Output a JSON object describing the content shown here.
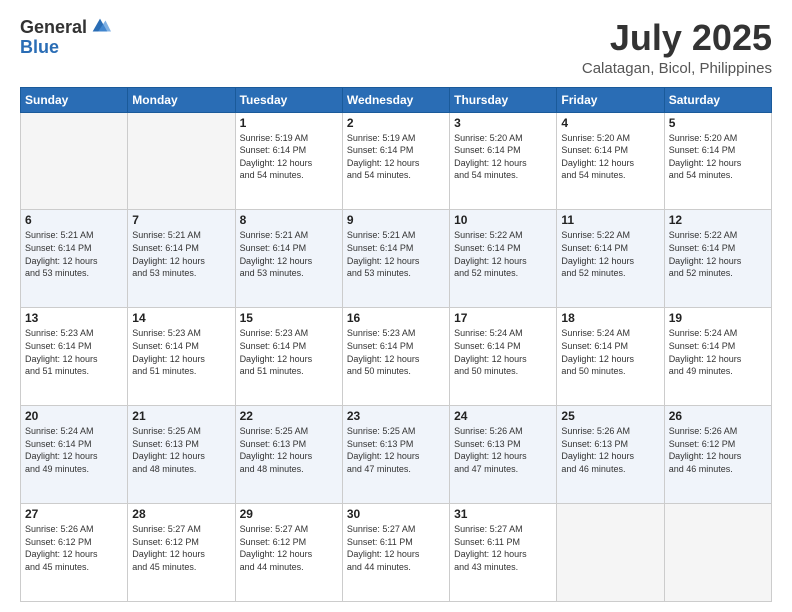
{
  "header": {
    "logo_general": "General",
    "logo_blue": "Blue",
    "month_title": "July 2025",
    "location": "Calatagan, Bicol, Philippines"
  },
  "days_of_week": [
    "Sunday",
    "Monday",
    "Tuesday",
    "Wednesday",
    "Thursday",
    "Friday",
    "Saturday"
  ],
  "weeks": [
    [
      {
        "day": "",
        "info": ""
      },
      {
        "day": "",
        "info": ""
      },
      {
        "day": "1",
        "info": "Sunrise: 5:19 AM\nSunset: 6:14 PM\nDaylight: 12 hours\nand 54 minutes."
      },
      {
        "day": "2",
        "info": "Sunrise: 5:19 AM\nSunset: 6:14 PM\nDaylight: 12 hours\nand 54 minutes."
      },
      {
        "day": "3",
        "info": "Sunrise: 5:20 AM\nSunset: 6:14 PM\nDaylight: 12 hours\nand 54 minutes."
      },
      {
        "day": "4",
        "info": "Sunrise: 5:20 AM\nSunset: 6:14 PM\nDaylight: 12 hours\nand 54 minutes."
      },
      {
        "day": "5",
        "info": "Sunrise: 5:20 AM\nSunset: 6:14 PM\nDaylight: 12 hours\nand 54 minutes."
      }
    ],
    [
      {
        "day": "6",
        "info": "Sunrise: 5:21 AM\nSunset: 6:14 PM\nDaylight: 12 hours\nand 53 minutes."
      },
      {
        "day": "7",
        "info": "Sunrise: 5:21 AM\nSunset: 6:14 PM\nDaylight: 12 hours\nand 53 minutes."
      },
      {
        "day": "8",
        "info": "Sunrise: 5:21 AM\nSunset: 6:14 PM\nDaylight: 12 hours\nand 53 minutes."
      },
      {
        "day": "9",
        "info": "Sunrise: 5:21 AM\nSunset: 6:14 PM\nDaylight: 12 hours\nand 53 minutes."
      },
      {
        "day": "10",
        "info": "Sunrise: 5:22 AM\nSunset: 6:14 PM\nDaylight: 12 hours\nand 52 minutes."
      },
      {
        "day": "11",
        "info": "Sunrise: 5:22 AM\nSunset: 6:14 PM\nDaylight: 12 hours\nand 52 minutes."
      },
      {
        "day": "12",
        "info": "Sunrise: 5:22 AM\nSunset: 6:14 PM\nDaylight: 12 hours\nand 52 minutes."
      }
    ],
    [
      {
        "day": "13",
        "info": "Sunrise: 5:23 AM\nSunset: 6:14 PM\nDaylight: 12 hours\nand 51 minutes."
      },
      {
        "day": "14",
        "info": "Sunrise: 5:23 AM\nSunset: 6:14 PM\nDaylight: 12 hours\nand 51 minutes."
      },
      {
        "day": "15",
        "info": "Sunrise: 5:23 AM\nSunset: 6:14 PM\nDaylight: 12 hours\nand 51 minutes."
      },
      {
        "day": "16",
        "info": "Sunrise: 5:23 AM\nSunset: 6:14 PM\nDaylight: 12 hours\nand 50 minutes."
      },
      {
        "day": "17",
        "info": "Sunrise: 5:24 AM\nSunset: 6:14 PM\nDaylight: 12 hours\nand 50 minutes."
      },
      {
        "day": "18",
        "info": "Sunrise: 5:24 AM\nSunset: 6:14 PM\nDaylight: 12 hours\nand 50 minutes."
      },
      {
        "day": "19",
        "info": "Sunrise: 5:24 AM\nSunset: 6:14 PM\nDaylight: 12 hours\nand 49 minutes."
      }
    ],
    [
      {
        "day": "20",
        "info": "Sunrise: 5:24 AM\nSunset: 6:14 PM\nDaylight: 12 hours\nand 49 minutes."
      },
      {
        "day": "21",
        "info": "Sunrise: 5:25 AM\nSunset: 6:13 PM\nDaylight: 12 hours\nand 48 minutes."
      },
      {
        "day": "22",
        "info": "Sunrise: 5:25 AM\nSunset: 6:13 PM\nDaylight: 12 hours\nand 48 minutes."
      },
      {
        "day": "23",
        "info": "Sunrise: 5:25 AM\nSunset: 6:13 PM\nDaylight: 12 hours\nand 47 minutes."
      },
      {
        "day": "24",
        "info": "Sunrise: 5:26 AM\nSunset: 6:13 PM\nDaylight: 12 hours\nand 47 minutes."
      },
      {
        "day": "25",
        "info": "Sunrise: 5:26 AM\nSunset: 6:13 PM\nDaylight: 12 hours\nand 46 minutes."
      },
      {
        "day": "26",
        "info": "Sunrise: 5:26 AM\nSunset: 6:12 PM\nDaylight: 12 hours\nand 46 minutes."
      }
    ],
    [
      {
        "day": "27",
        "info": "Sunrise: 5:26 AM\nSunset: 6:12 PM\nDaylight: 12 hours\nand 45 minutes."
      },
      {
        "day": "28",
        "info": "Sunrise: 5:27 AM\nSunset: 6:12 PM\nDaylight: 12 hours\nand 45 minutes."
      },
      {
        "day": "29",
        "info": "Sunrise: 5:27 AM\nSunset: 6:12 PM\nDaylight: 12 hours\nand 44 minutes."
      },
      {
        "day": "30",
        "info": "Sunrise: 5:27 AM\nSunset: 6:11 PM\nDaylight: 12 hours\nand 44 minutes."
      },
      {
        "day": "31",
        "info": "Sunrise: 5:27 AM\nSunset: 6:11 PM\nDaylight: 12 hours\nand 43 minutes."
      },
      {
        "day": "",
        "info": ""
      },
      {
        "day": "",
        "info": ""
      }
    ]
  ]
}
